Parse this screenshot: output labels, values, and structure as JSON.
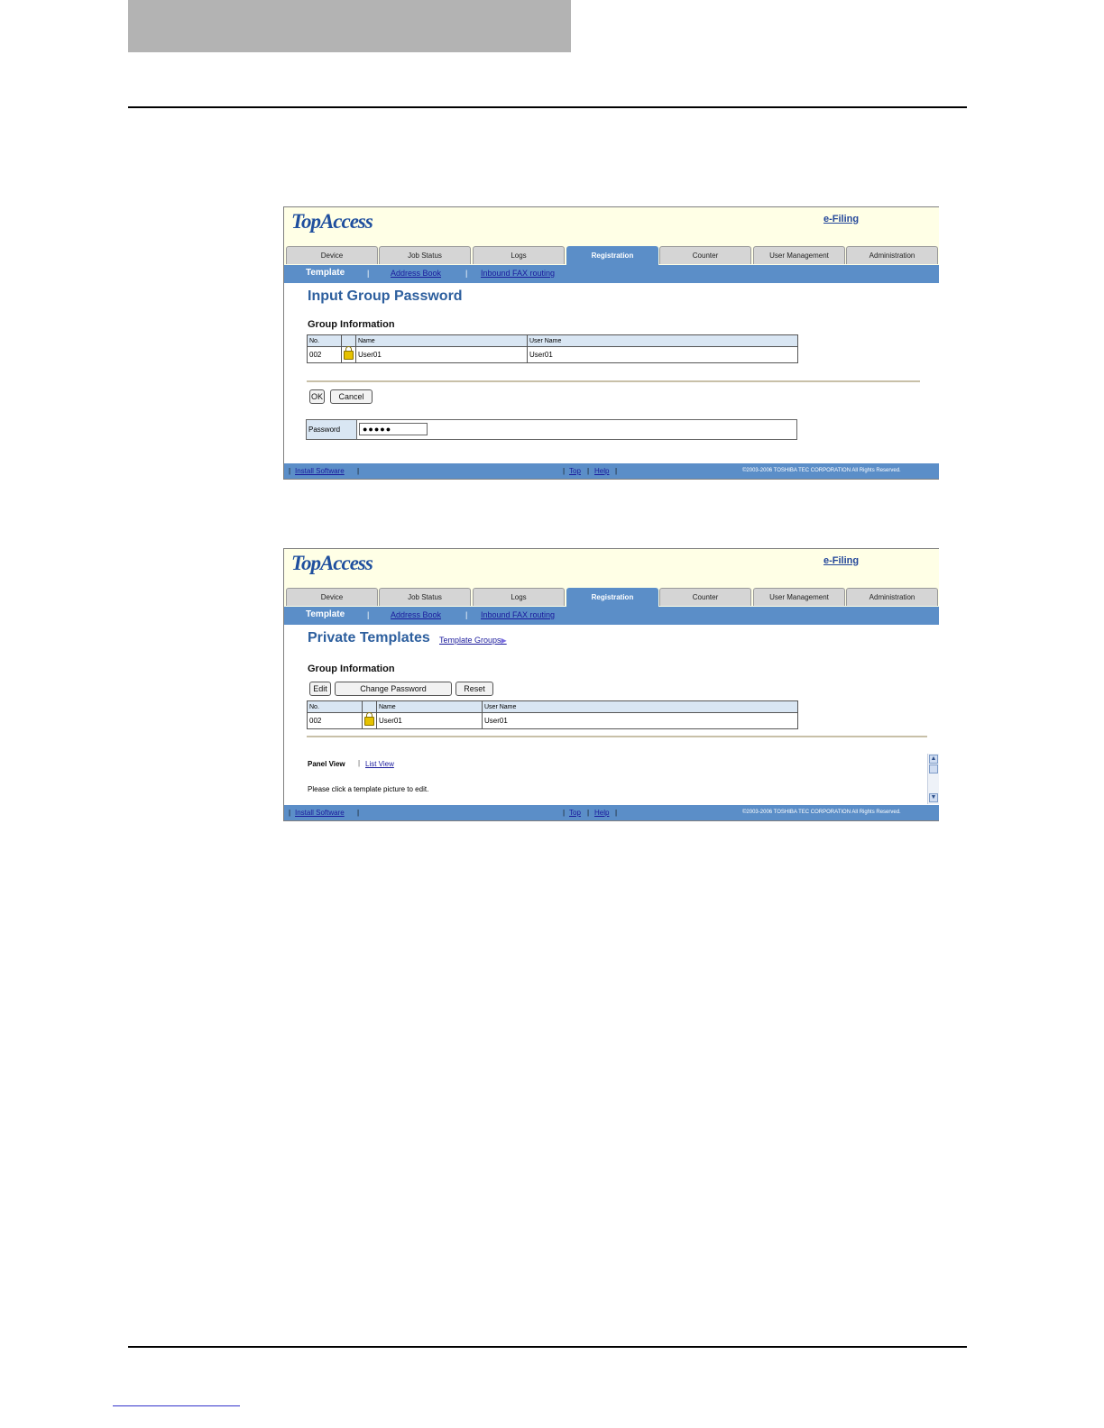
{
  "app": {
    "logo": "TopAccess",
    "efiling": "e-Filing",
    "tabs": [
      "Device",
      "Job Status",
      "Logs",
      "Registration",
      "Counter",
      "User Management",
      "Administration"
    ],
    "subnav": {
      "active": "Template",
      "sep": "|",
      "links": [
        "Address Book",
        "Inbound FAX routing"
      ]
    },
    "footer": {
      "install": "Install Software",
      "top": "Top",
      "help": "Help",
      "sep": "|",
      "copyright": "©2003-2006 TOSHIBA TEC CORPORATION All Rights Reserved."
    }
  },
  "screen1": {
    "title": "Input Group Password",
    "section": "Group Information",
    "columns": [
      "No.",
      "",
      "Name",
      "User Name"
    ],
    "row": {
      "no": "002",
      "name": "User01",
      "user_name": "User01"
    },
    "ok_label": "OK",
    "cancel_label": "Cancel",
    "password_label": "Password",
    "password_value": "●●●●●"
  },
  "screen2": {
    "title": "Private Templates",
    "template_groups_link": "Template Groups",
    "section": "Group Information",
    "edit_label": "Edit",
    "change_password_label": "Change Password",
    "reset_label": "Reset",
    "columns": [
      "No.",
      "",
      "Name",
      "User Name"
    ],
    "row": {
      "no": "002",
      "name": "User01",
      "user_name": "User01"
    },
    "panel_view": "Panel View",
    "view_sep": "|",
    "list_view": "List View",
    "instruction": "Please click a template picture to edit."
  }
}
